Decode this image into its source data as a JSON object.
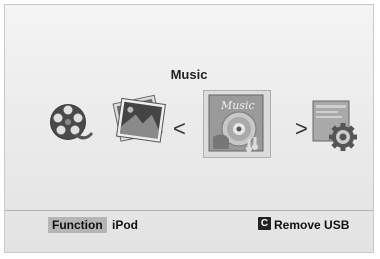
{
  "menu": {
    "selected_title": "Music",
    "items": [
      {
        "name": "video",
        "icon": "film-reel-icon"
      },
      {
        "name": "photos",
        "icon": "photo-stack-icon"
      },
      {
        "name": "music",
        "icon": "music-disc-icon",
        "selected": true
      },
      {
        "name": "setup",
        "icon": "settings-gear-icon"
      }
    ],
    "prev_arrow": "<",
    "next_arrow": ">"
  },
  "footer": {
    "function_label": "Function",
    "function_value": "iPod",
    "remove_key": "C",
    "remove_label": "Remove USB"
  }
}
